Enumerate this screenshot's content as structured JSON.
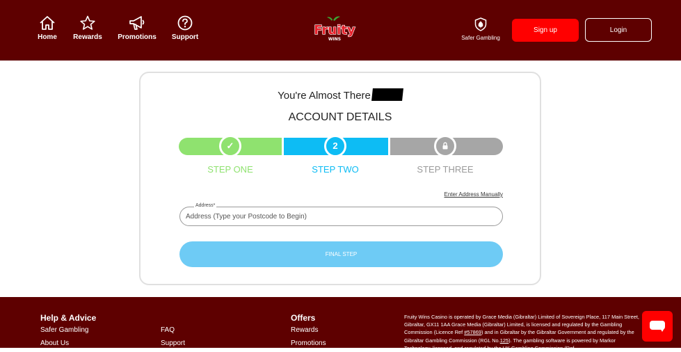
{
  "header": {
    "nav": [
      {
        "label": "Home",
        "icon": "home-icon"
      },
      {
        "label": "Rewards",
        "icon": "star-icon"
      },
      {
        "label": "Promotions",
        "icon": "megaphone-icon"
      },
      {
        "label": "Support",
        "icon": "question-icon"
      }
    ],
    "logo_main": "Fruity",
    "logo_sub": "WINS",
    "safer_gambling": "Safer Gambling",
    "signup_label": "Sign up",
    "login_label": "Login",
    "colors": {
      "bar": "#5e0000",
      "signup": "#ff0000"
    }
  },
  "card": {
    "title": "You're Almost There",
    "subtitle": "ACCOUNT DETAILS",
    "steps": [
      {
        "label": "STEP ONE",
        "marker": "✓",
        "state": "complete",
        "color": "#8fe26f"
      },
      {
        "label": "STEP TWO",
        "marker": "2",
        "state": "current",
        "color": "#0dbcf4"
      },
      {
        "label": "STEP THREE",
        "marker": "lock-icon",
        "state": "locked",
        "color": "#a6a6a6"
      }
    ],
    "manual_link": "Enter Address Manually",
    "address_label": "Address*",
    "address_placeholder": "Address (Type your Postcode to Begin)",
    "address_value": "",
    "final_button": "FINAL STEP"
  },
  "footer": {
    "help_heading": "Help & Advice",
    "help_links": [
      "Safer Gambling",
      "About Us"
    ],
    "help_links_col2": [
      "FAQ",
      "Support"
    ],
    "offers_heading": "Offers",
    "offers_links": [
      "Rewards",
      "Promotions"
    ],
    "legal_1": "Fruity Wins Casino is operated by Grace Media (Gibraltar) Limited of Sovereign Place, 117 Main Street, Gibraltar, GX11 1AA Grace Media (Gibraltar) Limited, is licensed and regulated by the Gambling Commission (Licence Ref ",
    "legal_ref1": "#57869",
    "legal_2": ") and in Gibraltar by the Gibraltar Government and regulated by the Gibraltar Gambling Commission (RGL No.",
    "legal_ref2": "125",
    "legal_3": "). The gambling software is powered by Markor Technology, licensed, and regulated by the UK Gambling Commission (Ref",
    "chat_icon": "chat-icon"
  }
}
